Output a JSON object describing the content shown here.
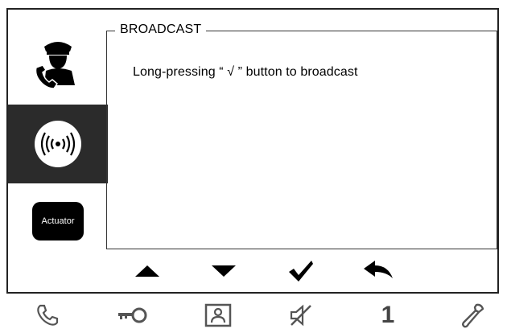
{
  "sidebar": {
    "items": [
      {
        "name": "guard-call",
        "icon": "guard-icon",
        "active": false
      },
      {
        "name": "broadcast",
        "icon": "broadcast-icon",
        "active": true
      },
      {
        "name": "actuator",
        "icon": "actuator-icon",
        "label": "Actuator",
        "active": false
      }
    ]
  },
  "panel": {
    "title": "BROADCAST",
    "message": "Long-pressing “ √ ” button to broadcast"
  },
  "nav": {
    "buttons": [
      {
        "icon": "triangle-up-icon"
      },
      {
        "icon": "triangle-down-icon"
      },
      {
        "icon": "checkmark-icon"
      },
      {
        "icon": "back-arrow-icon"
      }
    ]
  },
  "bottom_bar": {
    "buttons": [
      {
        "icon": "phone-icon"
      },
      {
        "icon": "key-icon"
      },
      {
        "icon": "monitor-icon"
      },
      {
        "icon": "mute-icon"
      },
      {
        "icon": "digit-1",
        "label": "1"
      },
      {
        "icon": "wrench-icon"
      }
    ]
  },
  "colors": {
    "frame": "#222222",
    "active_sidebar_bg": "#2b2b2b",
    "bottom_icon": "#555555"
  }
}
